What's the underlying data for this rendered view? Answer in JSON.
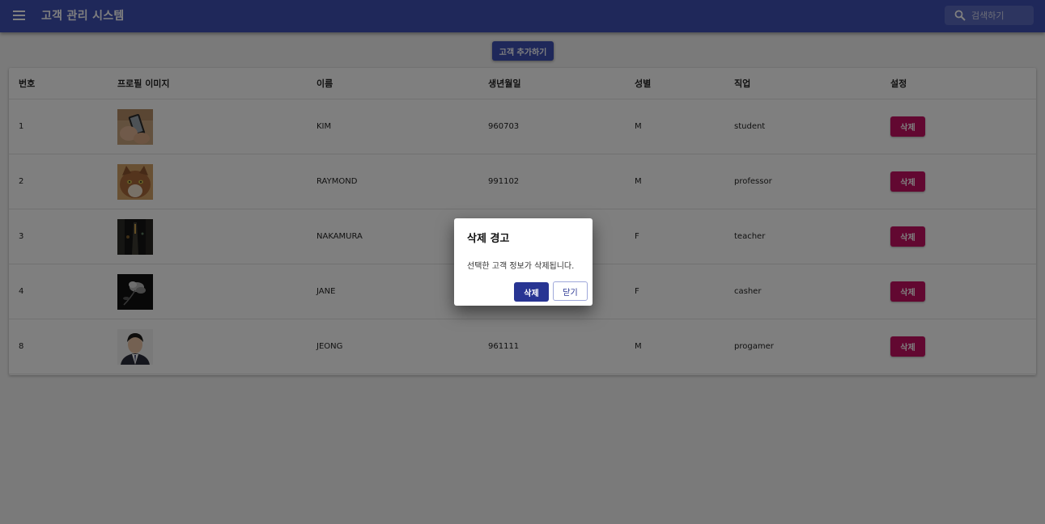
{
  "appbar": {
    "title": "고객 관리 시스템",
    "menu_icon": "menu-icon",
    "search_icon": "search-icon",
    "search_placeholder": "검색하기",
    "background_color": "#3f51b5"
  },
  "add_button_label": "고객 추가하기",
  "table": {
    "headers": [
      "번호",
      "프로필 이미지",
      "이름",
      "생년월일",
      "성별",
      "직업",
      "설정"
    ],
    "rows": [
      {
        "id": "1",
        "name": "KIM",
        "birthday": "960703",
        "gender": "M",
        "job": "student",
        "delete_label": "삭제",
        "image": "phone-photo"
      },
      {
        "id": "2",
        "name": "RAYMOND",
        "birthday": "991102",
        "gender": "M",
        "job": "professor",
        "delete_label": "삭제",
        "image": "cat-photo"
      },
      {
        "id": "3",
        "name": "NAKAMURA",
        "birthday": "",
        "gender": "F",
        "job": "teacher",
        "delete_label": "삭제",
        "image": "dark-street-photo"
      },
      {
        "id": "4",
        "name": "JANE",
        "birthday": "",
        "gender": "F",
        "job": "casher",
        "delete_label": "삭제",
        "image": "dark-flower-photo"
      },
      {
        "id": "8",
        "name": "JEONG",
        "birthday": "961111",
        "gender": "M",
        "job": "progamer",
        "delete_label": "삭제",
        "image": "portrait-photo"
      }
    ],
    "delete_color": "#c51162"
  },
  "dialog": {
    "title": "삭제 경고",
    "message": "선택한 고객 정보가 삭제됩니다.",
    "confirm_label": "삭제",
    "close_label": "닫기"
  }
}
